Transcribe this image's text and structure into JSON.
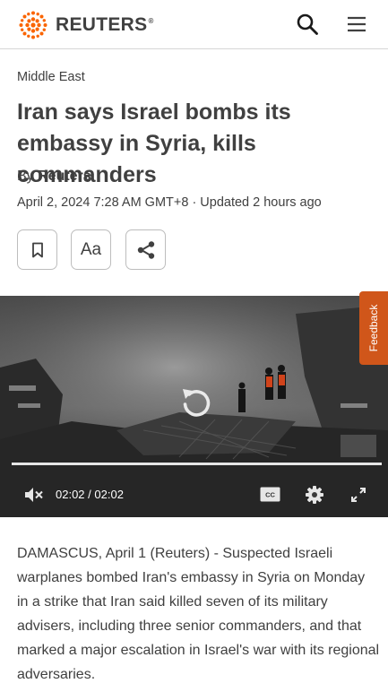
{
  "header": {
    "brand": "REUTERS",
    "brand_mark": "®",
    "brand_color": "#fa6400"
  },
  "article": {
    "section": "Middle East",
    "headline": "Iran says Israel bombs its embassy in Syria, kills commanders",
    "by_prefix": "By",
    "author": "Reuters",
    "dateline": "April 2, 2024 7:28 AM GMT+8 · Updated 2 hours ago",
    "body": "DAMASCUS, April 1 (Reuters) - Suspected Israeli warplanes bombed Iran's embassy in Syria on Monday in a strike that Iran said killed seven of its military advisers, including three senior commanders, and that marked a major escalation in Israel's war with its regional adversaries."
  },
  "toolbar": {
    "text_size_label": "Aa"
  },
  "video": {
    "time_current": "02:02",
    "time_separator": "/",
    "time_total": "02:02",
    "progress": 1.0
  },
  "feedback": {
    "label": "Feedback",
    "color": "#d0561a"
  },
  "icons": [
    "search-icon",
    "menu-icon",
    "bookmark-icon",
    "share-icon",
    "replay-icon",
    "mute-icon",
    "captions-icon",
    "gear-icon",
    "fullscreen-icon"
  ]
}
